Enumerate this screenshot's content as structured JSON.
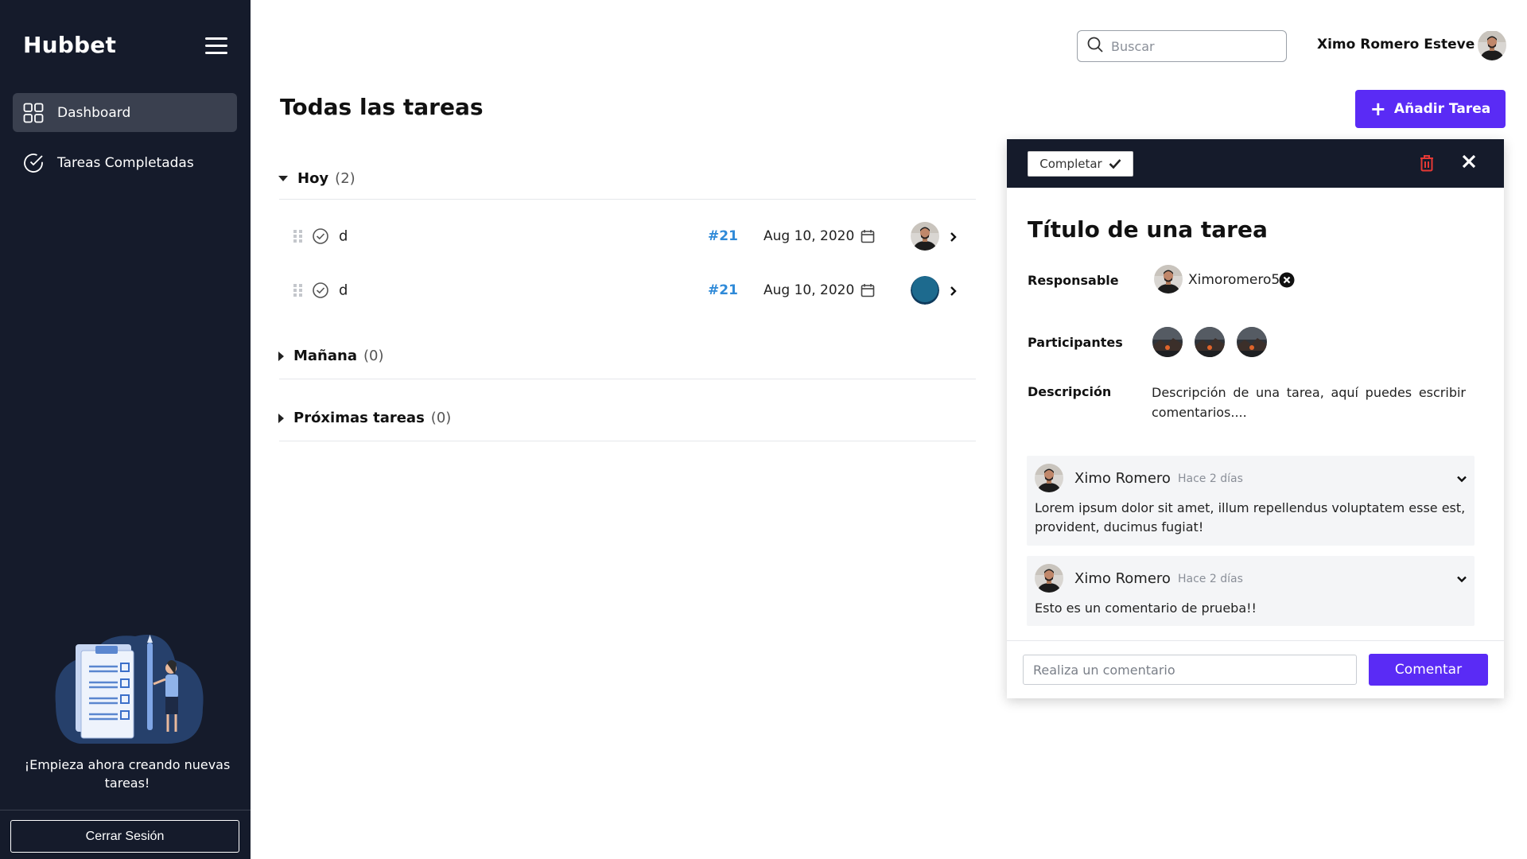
{
  "app": {
    "brand": "Hubbet"
  },
  "sidebar": {
    "items": [
      {
        "label": "Dashboard",
        "icon": "dashboard-grid-icon",
        "active": true
      },
      {
        "label": "Tareas Completadas",
        "icon": "check-circle-icon",
        "active": false
      }
    ],
    "promo_text": "¡Empieza ahora creando nuevas tareas!",
    "logout_label": "Cerrar Sesión"
  },
  "header": {
    "search_placeholder": "Buscar",
    "user_name": "Ximo Romero Esteve"
  },
  "main": {
    "title": "Todas las tareas",
    "add_button_label": "Añadir Tarea",
    "groups": [
      {
        "name": "Hoy",
        "count": "(2)",
        "expanded": true,
        "tasks": [
          {
            "name": "d",
            "id": "#21",
            "date": "Aug 10, 2020",
            "assignee_avatar": "photo"
          },
          {
            "name": "d",
            "id": "#21",
            "date": "Aug 10, 2020",
            "assignee_avatar": "blue-circle"
          }
        ]
      },
      {
        "name": "Mañana",
        "count": "(0)",
        "expanded": false
      },
      {
        "name": "Próximas tareas",
        "count": "(0)",
        "expanded": false
      }
    ]
  },
  "detail": {
    "complete_label": "Completar",
    "title": "Título de una tarea",
    "responsable_label": "Responsable",
    "responsable_name": "Ximoromero5",
    "participantes_label": "Participantes",
    "participant_count": 3,
    "descripcion_label": "Descripción",
    "descripcion": "Descripción de una tarea, aquí puedes escribir comentarios....",
    "comments": [
      {
        "author": "Ximo Romero",
        "time": "Hace 2 días",
        "text": "Lorem ipsum dolor sit amet, illum repellendus voluptatem esse est, provident, ducimus fugiat!"
      },
      {
        "author": "Ximo Romero",
        "time": "Hace 2 días",
        "text": "Esto es un comentario de prueba!!"
      }
    ],
    "comment_placeholder": "Realiza un comentario",
    "comment_button_label": "Comentar"
  },
  "colors": {
    "sidebar_bg": "#151b2b",
    "accent": "#5a2bf5",
    "task_id": "#2f8ad8",
    "danger": "#e53935"
  }
}
